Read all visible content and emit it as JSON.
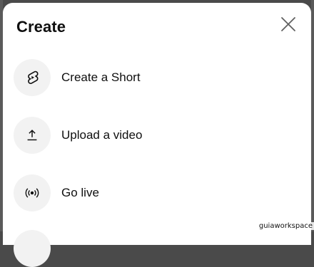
{
  "dialog": {
    "title": "Create",
    "close_icon": "close-icon"
  },
  "menu": {
    "items": [
      {
        "label": "Create a Short",
        "icon": "shorts-icon"
      },
      {
        "label": "Upload a video",
        "icon": "upload-icon"
      },
      {
        "label": "Go live",
        "icon": "live-broadcast-icon"
      }
    ]
  },
  "watermark": "guiaworkspace",
  "colors": {
    "sheet": "#ffffff",
    "icon_circle": "#f2f2f2",
    "text": "#0f0f0f",
    "backdrop": "#4a4a4a"
  }
}
